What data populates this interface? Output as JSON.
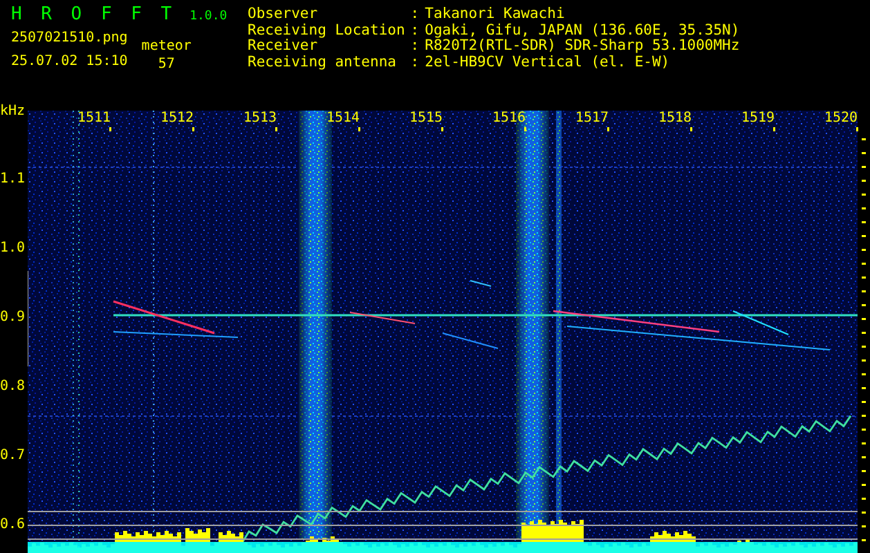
{
  "header": {
    "app_name": "H R O F F T",
    "version": "1.0.0",
    "filename": "2507021510.png",
    "timestamp": "25.07.02 15:10",
    "counter_label": "meteor",
    "counter_value": "57"
  },
  "info": [
    {
      "label": "Observer",
      "separator": ":",
      "value": "Takanori Kawachi"
    },
    {
      "label": "Receiving Location",
      "separator": ":",
      "value": "Ogaki, Gifu, JAPAN (136.60E, 35.35N)"
    },
    {
      "label": "Receiver",
      "separator": ":",
      "value": "R820T2(RTL-SDR) SDR-Sharp 53.1000MHz"
    },
    {
      "label": "Receiving antenna",
      "separator": ":",
      "value": "2el-HB9CV Vertical (el. E-W)"
    }
  ],
  "spectrogram": {
    "unit": "kHz",
    "time_labels": [
      "1511",
      "1512",
      "1513",
      "1514",
      "1515",
      "1516",
      "1517",
      "1518",
      "1519",
      "1520"
    ],
    "freq_labels": [
      "1.1",
      "1.0",
      "0.9",
      "0.8",
      "0.7",
      "0.6"
    ]
  }
}
